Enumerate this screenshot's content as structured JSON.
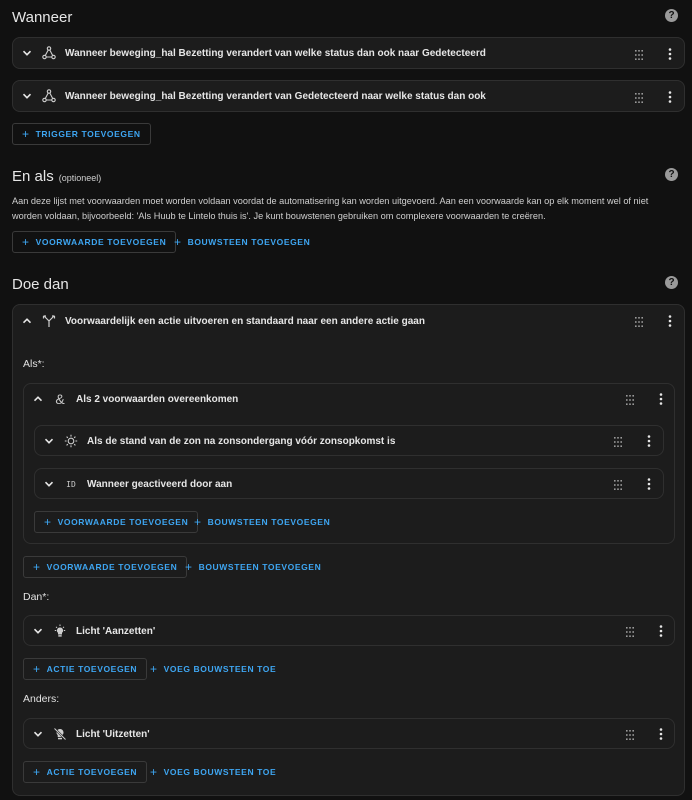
{
  "wanneer": {
    "title": "Wanneer",
    "triggers": [
      {
        "label": "Wanneer beweging_hal Bezetting verandert van welke status dan ook naar Gedetecteerd"
      },
      {
        "label": "Wanneer beweging_hal Bezetting verandert van Gedetecteerd naar welke status dan ook"
      }
    ],
    "add_trigger": "TRIGGER TOEVOEGEN"
  },
  "enals": {
    "title": "En als",
    "optional": "(optioneel)",
    "description": "Aan deze lijst met voorwaarden moet worden voldaan voordat de automatisering kan worden uitgevoerd. Aan een voorwaarde kan op elk moment wel of niet worden voldaan, bijvoorbeeld: 'Als Huub te Lintelo thuis is'. Je kunt bouwstenen gebruiken om complexere voorwaarden te creëren.",
    "add_condition": "VOORWAARDE TOEVOEGEN",
    "add_block": "BOUWSTEEN TOEVOEGEN"
  },
  "doedan": {
    "title": "Doe dan",
    "choose_card": {
      "label": "Voorwaardelijk een actie uitvoeren en standaard naar een andere actie gaan",
      "als_label": "Als*:",
      "and_card": {
        "label": "Als 2 voorwaarden overeenkomen",
        "conditions": [
          {
            "label": "Als de stand van de zon na zonsondergang vóór zonsopkomst is"
          },
          {
            "label": "Wanneer geactiveerd door aan",
            "id_text": "ID"
          }
        ],
        "add_condition": "VOORWAARDE TOEVOEGEN",
        "add_block": "BOUWSTEEN TOEVOEGEN"
      },
      "add_condition": "VOORWAARDE TOEVOEGEN",
      "add_block": "BOUWSTEEN TOEVOEGEN",
      "dan_label": "Dan*:",
      "dan_action": "Licht 'Aanzetten'",
      "add_action": "ACTIE TOEVOEGEN",
      "add_block_action": "VOEG BOUWSTEEN TOE",
      "anders_label": "Anders:",
      "anders_action": "Licht 'Uitzetten'",
      "add_action2": "ACTIE TOEVOEGEN",
      "add_block_action2": "VOEG BOUWSTEEN TOE"
    }
  },
  "help_text": "?",
  "plus": "+",
  "colors": {
    "accent": "#3ea6f2",
    "background": "#111111",
    "card": "#1c1c1c"
  },
  "icons": [
    "chevron-down-icon",
    "chevron-up-icon",
    "trigger-state-icon",
    "choose-icon",
    "and-icon",
    "sun-icon",
    "light-on-icon",
    "light-off-icon",
    "drag-handle-icon",
    "overflow-menu-icon",
    "help-icon"
  ]
}
